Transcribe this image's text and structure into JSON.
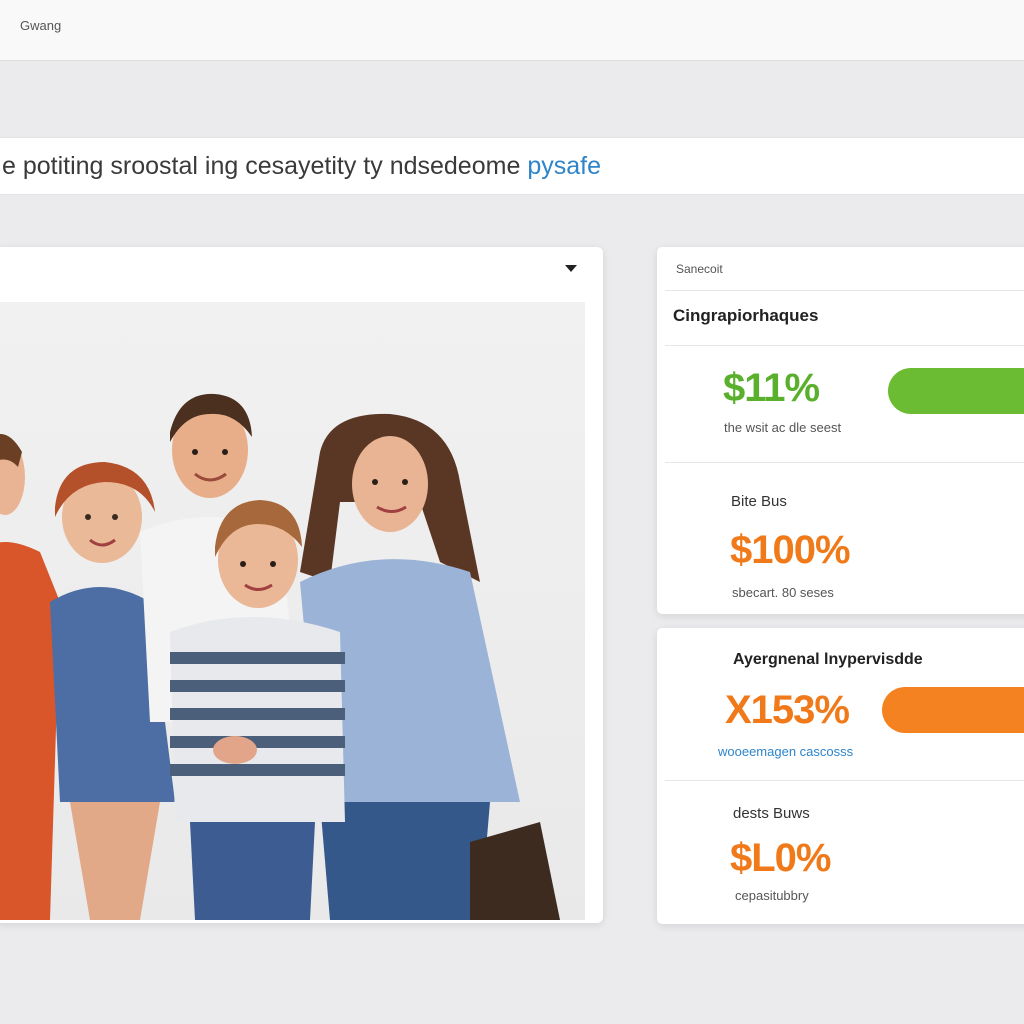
{
  "topbar": {
    "title": "Gwang"
  },
  "headline": {
    "text": "e potiting sroostal ing cesayetity ty ndsedeome",
    "link": "pysafe"
  },
  "image_panel": {
    "dropdown_icon": "caret-down-icon",
    "photo_alt": "family-photo"
  },
  "stats_card": {
    "header": "Sanecoit",
    "title": "Cingrapiorhaques",
    "metrics": [
      {
        "value": "$11%",
        "label": "the wsit ac dle seest",
        "bar_fill": 0.4,
        "color": "#6bbc33"
      },
      {
        "title": "Bite Bus",
        "value": "$100%",
        "label": "sbecart. 80 seses"
      }
    ]
  },
  "second_card": {
    "title": "Ayergnenal lnypervisdde",
    "metrics": [
      {
        "value": "X153%",
        "label": "wooeemagen cascosss",
        "bar_fill": 0.42,
        "color": "#f58220"
      },
      {
        "title": "dests Buws",
        "value": "$L0%",
        "label": "cepasitubbry"
      }
    ]
  },
  "colors": {
    "accent_green": "#5ab02d",
    "accent_orange": "#f07a1a",
    "link_blue": "#2e84c9"
  }
}
